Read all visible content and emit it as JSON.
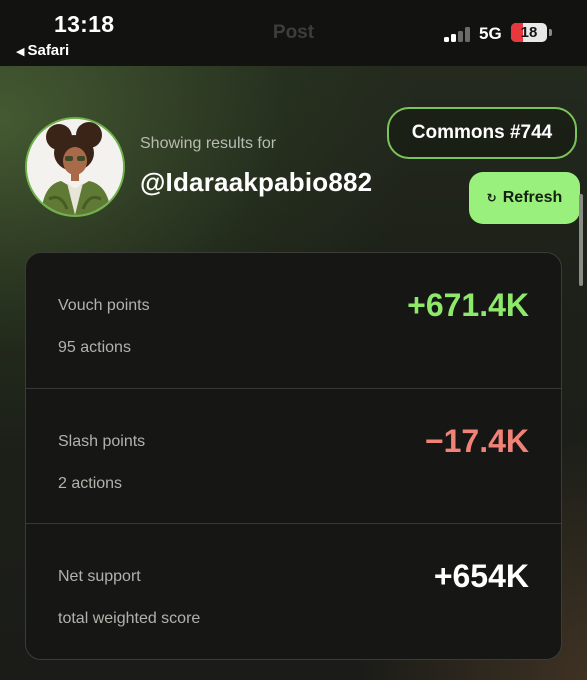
{
  "status_bar": {
    "time": "13:18",
    "back_app": "Safari",
    "network": "5G",
    "battery": "18"
  },
  "nav": {
    "title": "Post"
  },
  "header": {
    "showing_label": "Showing results for",
    "handle": "@Idaraakpabio882",
    "commons_button": "Commons #744",
    "refresh_button": "Refresh"
  },
  "stats": [
    {
      "label": "Vouch points",
      "value": "+671.4K",
      "sub": "95 actions",
      "color": "#8ee86a"
    },
    {
      "label": "Slash points",
      "value": "−17.4K",
      "sub": "2 actions",
      "color": "#f08278"
    },
    {
      "label": "Net support",
      "value": "+654K",
      "sub": "total weighted score",
      "color": "#ffffff"
    }
  ],
  "colors": {
    "accent": "#9af07c",
    "positive": "#8ee86a",
    "negative": "#f08278"
  }
}
